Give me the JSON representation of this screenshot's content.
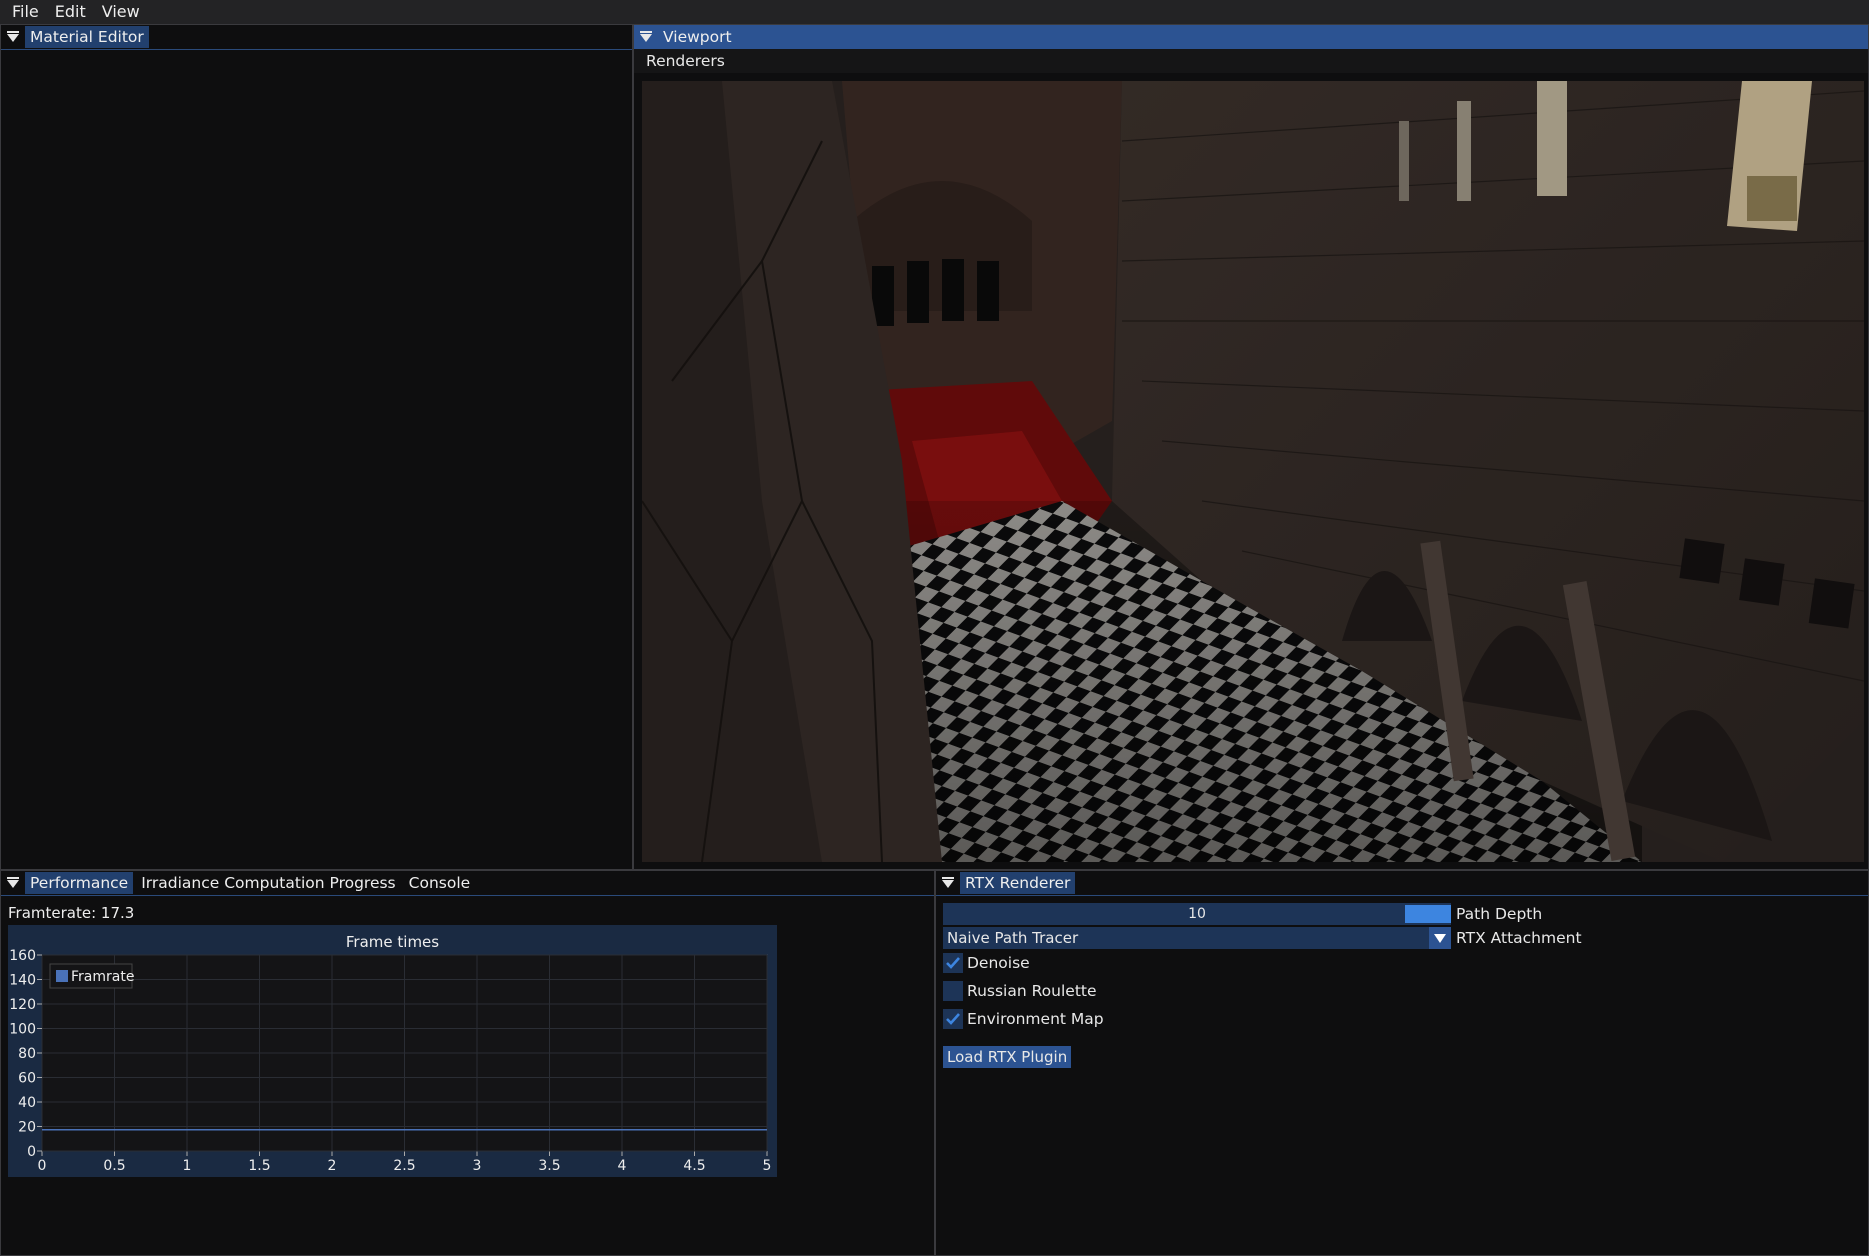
{
  "menubar": {
    "file": "File",
    "edit": "Edit",
    "view": "View"
  },
  "material_editor": {
    "title": "Material Editor"
  },
  "viewport": {
    "title": "Viewport",
    "renderers_menu": "Renderers"
  },
  "performance_panel": {
    "tabs": [
      "Performance",
      "Irradiance Computation Progress",
      "Console"
    ],
    "framerate_label": "Framterate: 17.3"
  },
  "chart_data": {
    "type": "line",
    "title": "Frame times",
    "xlabel": "",
    "ylabel": "",
    "xlim": [
      0,
      5
    ],
    "ylim": [
      0,
      160
    ],
    "x_ticks": [
      "0",
      "0.5",
      "1",
      "1.5",
      "2",
      "2.5",
      "3",
      "3.5",
      "4",
      "4.5",
      "5"
    ],
    "y_ticks": [
      "0",
      "20",
      "40",
      "60",
      "80",
      "100",
      "120",
      "140",
      "160"
    ],
    "grid": true,
    "legend_position": "top-left",
    "series": [
      {
        "name": "Framrate",
        "color": "#4a72b8",
        "x": [
          0,
          5
        ],
        "y": [
          17.3,
          17.3
        ]
      }
    ]
  },
  "rtx_renderer": {
    "title": "RTX Renderer",
    "path_depth_value": "10",
    "path_depth_label": "Path Depth",
    "attachment_value": "Naive Path Tracer",
    "attachment_label": "RTX Attachment",
    "checkboxes": [
      {
        "label": "Denoise",
        "checked": true
      },
      {
        "label": "Russian Roulette",
        "checked": false
      },
      {
        "label": "Environment Map",
        "checked": true
      }
    ],
    "load_button": "Load RTX Plugin"
  },
  "colors": {
    "accent": "#2c5392",
    "slider_grab": "#3d85e0",
    "frame_bg": "#1d3457"
  }
}
